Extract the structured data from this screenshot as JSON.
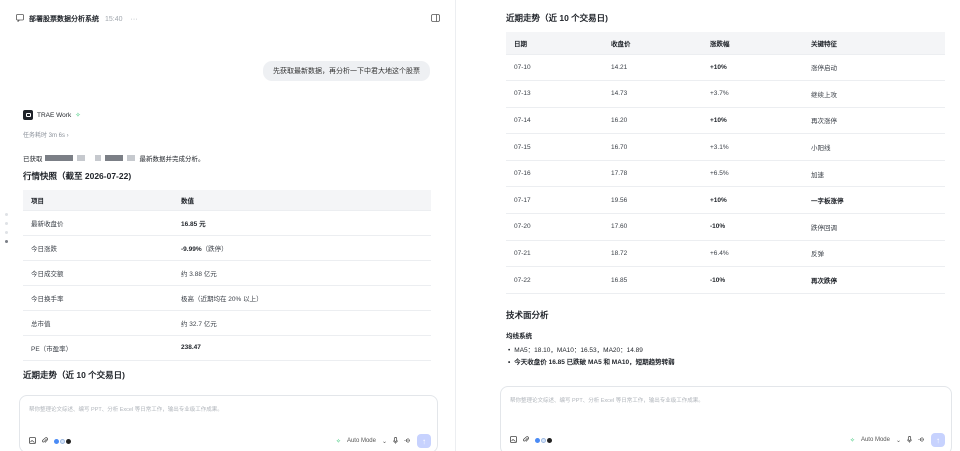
{
  "header": {
    "title": "部署股票数据分析系统",
    "time": "15:40",
    "more": "···"
  },
  "user_message": "先获取最新数据，再分析一下中君大地这个股票",
  "agent": {
    "name": "TRAE Work",
    "star": "✧",
    "elapsed": "任务耗时 3m 6s ›"
  },
  "summary": {
    "prefix": "已获取",
    "suffix": "最新数据并完成分析。"
  },
  "snapshot": {
    "title": "行情快照（截至 2026-07-22)",
    "columns": [
      "项目",
      "数值"
    ],
    "rows": [
      [
        "最新收盘价",
        "16.85 元"
      ],
      [
        "今日涨跌",
        "-9.99%",
        "（跌停）"
      ],
      [
        "今日成交额",
        "约 3.88 亿元"
      ],
      [
        "今日换手率",
        "极高（近期均在 20% 以上）"
      ],
      [
        "总市值",
        "约 32.7 亿元"
      ],
      [
        "PE（市盈率）",
        "238.47"
      ]
    ]
  },
  "trend_title": "近期走势（近 10 个交易日)",
  "trend": {
    "columns": [
      "日期",
      "收盘价",
      "涨跌幅",
      "关键特征"
    ],
    "rows": [
      [
        "07-10",
        "14.21",
        "+10%",
        "涨停启动"
      ],
      [
        "07-13",
        "14.73",
        "+3.7%",
        "继续上攻"
      ],
      [
        "07-14",
        "16.20",
        "+10%",
        "再次涨停"
      ],
      [
        "07-15",
        "16.70",
        "+3.1%",
        "小阳线"
      ],
      [
        "07-16",
        "17.78",
        "+6.5%",
        "加速"
      ],
      [
        "07-17",
        "19.56",
        "+10%",
        "一字板涨停"
      ],
      [
        "07-20",
        "17.60",
        "-10%",
        "跌停回调"
      ],
      [
        "07-21",
        "18.72",
        "+6.4%",
        "反弹"
      ],
      [
        "07-22",
        "16.85",
        "-10%",
        "再次跌停"
      ]
    ]
  },
  "tech": {
    "title": "技术面分析",
    "subtitle": "均线系统",
    "bullets": [
      "MA5：18.10，MA10：16.53，MA20：14.89",
      "今天收盘价 16.85 已跌破 MA5 和 MA10，短期趋势转弱"
    ]
  },
  "composer": {
    "placeholder": "帮你整理论文综述、编写 PPT、分析 Excel 等日常工作，输出专业级工作成果。",
    "mode": "Auto Mode",
    "mode_caret": "⌄",
    "send": "↑"
  },
  "colors": {
    "accent": "#27c26c",
    "send_disabled": "#c7d2fe",
    "table_header": "#f4f5f7"
  }
}
